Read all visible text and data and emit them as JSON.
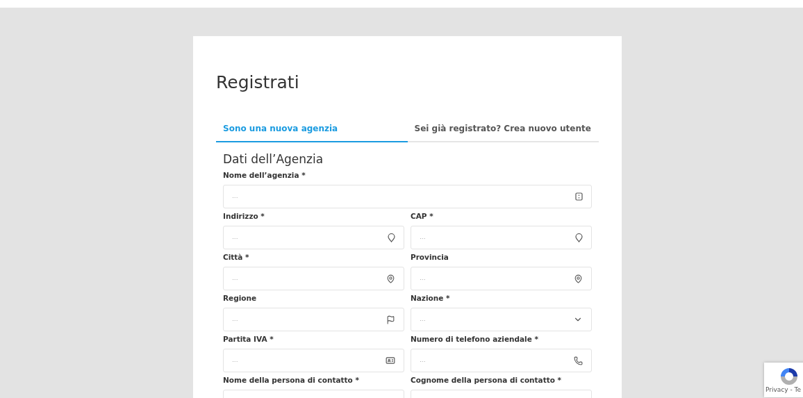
{
  "title": "Registrati",
  "tabs": [
    {
      "label": "Sono una nuova agenzia",
      "selected": true
    },
    {
      "label": "Sei già registrato? Crea nuovo utente",
      "selected": false
    }
  ],
  "section_title": "Dati dell’Agenzia",
  "rows": [
    [
      {
        "label": "Nome dell’agenzia *",
        "placeholder": "...",
        "kind": "text"
      }
    ],
    [
      {
        "label": "Indirizzo *",
        "placeholder": "...",
        "kind": "text"
      },
      {
        "label": "CAP *",
        "placeholder": "...",
        "kind": "text"
      }
    ],
    [
      {
        "label": "Città *",
        "placeholder": "...",
        "kind": "text"
      },
      {
        "label": "Provincia",
        "placeholder": "...",
        "kind": "text"
      }
    ],
    [
      {
        "label": "Regione",
        "placeholder": "...",
        "kind": "text"
      },
      {
        "label": "Nazione *",
        "placeholder": "...",
        "kind": "select"
      }
    ],
    [
      {
        "label": "Partita IVA *",
        "placeholder": "...",
        "kind": "text"
      },
      {
        "label": "Numero di telefono aziendale *",
        "placeholder": "...",
        "kind": "text"
      }
    ],
    [
      {
        "label": "Nome della persona di contatto *",
        "kind": "text"
      },
      {
        "label": "Cognome della persona di contatto *",
        "kind": "text"
      }
    ]
  ],
  "recaptcha": {
    "text": "Privacy - Te"
  }
}
